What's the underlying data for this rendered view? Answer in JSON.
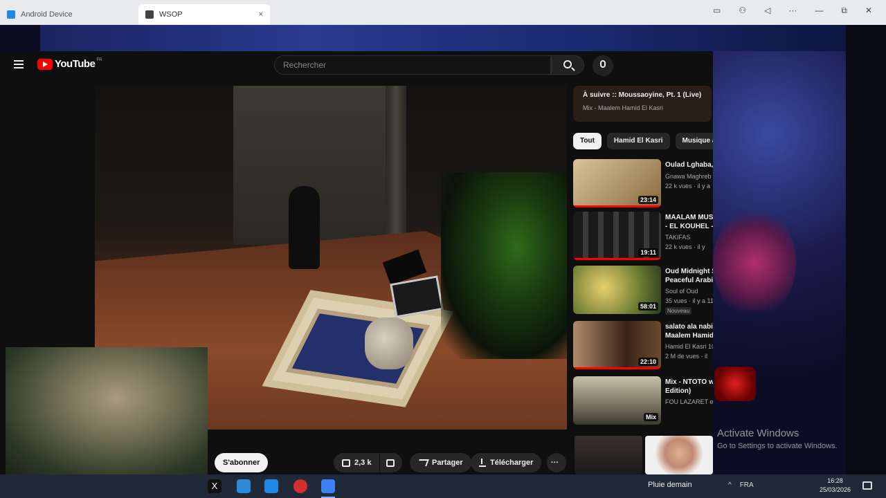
{
  "browser": {
    "tabs": [
      {
        "title": "Android Device",
        "active": false
      },
      {
        "title": "WSOP",
        "active": true
      }
    ],
    "close_glyph": "×",
    "window_controls": [
      "▭",
      "⚇",
      "◁",
      "···",
      "—",
      "⧉",
      "✕"
    ]
  },
  "youtube": {
    "logo_text": "YouTube",
    "logo_sup": "FR",
    "search": {
      "placeholder": "Rechercher"
    },
    "now_playing": {
      "title": "À suivre :: Moussaoyine, Pt. 1 (Live)",
      "subtitle": "Mix - Maalem Hamid El Kasri"
    },
    "chips": [
      "Tout",
      "Hamid El Kasri",
      "Musique af"
    ],
    "recommendations": [
      {
        "title": "Oulad Lghaba,",
        "channel": "Gnawa Maghreb",
        "meta": "22 k vues · il y a",
        "duration": "23:14",
        "thumb_color": "#c9b28a"
      },
      {
        "title": "MAALAM MUS",
        "title2": "- EL KOUHEL -",
        "channel": "TAKIFAS",
        "meta": "22 k vues · il y",
        "duration": "19:11",
        "thumb_color": "#2a2a2a"
      },
      {
        "title": "Oud Midnight S",
        "title2": "Peaceful Arabi",
        "channel": "Soul of Oud",
        "meta": "35 vues · il y a 11",
        "duration": "58:01",
        "badge": "Nouveau",
        "thumb_color": "#8a8a30"
      },
      {
        "title": "salato ala nabi",
        "title2": "Maalem Hamid",
        "channel": "Hamid El Kasri 10",
        "meta": "2 M de vues · il",
        "duration": "22:10",
        "thumb_color": "#5a3a2a"
      },
      {
        "title": "Mix - NTOTO w",
        "title2": "Edition)",
        "channel": "FOU LAZARET et",
        "meta": "",
        "duration": "Mix",
        "thumb_color": "#7a7a6a"
      }
    ],
    "actions": {
      "subscribe": "S'abonner",
      "likes": "2,3 k",
      "share": "Partager",
      "download": "Télécharger",
      "more": "···"
    }
  },
  "overlay": {
    "activate_title": "Activate Windows",
    "activate_sub": "Go to Settings to activate Windows."
  },
  "taskbar": {
    "weather": "Pluie demain",
    "lang": "FRA",
    "time": "16:28",
    "date": "25/03/2026",
    "tray_arrow": "^"
  }
}
